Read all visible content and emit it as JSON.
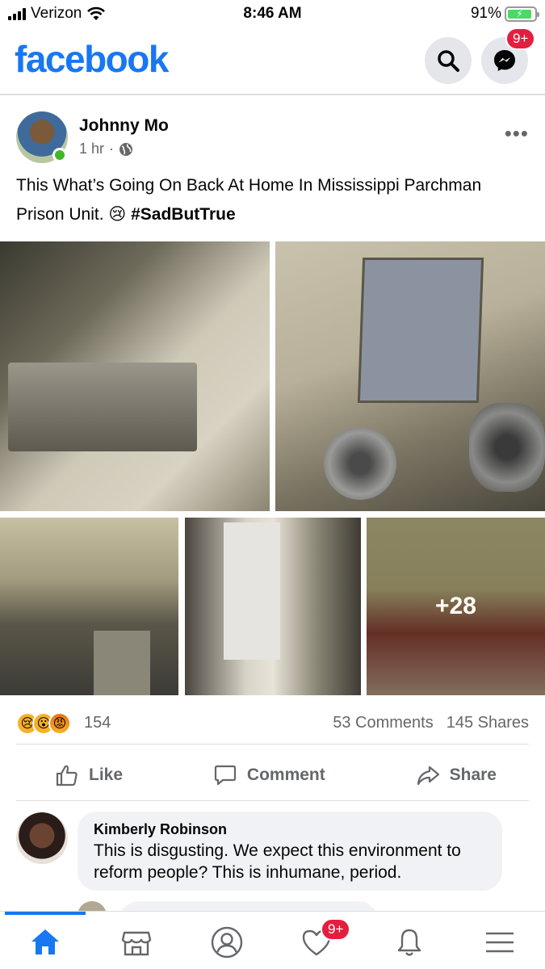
{
  "status_bar": {
    "carrier": "Verizon",
    "time": "8:46 AM",
    "battery": "91%",
    "battery_level": 0.91
  },
  "header": {
    "logo": "facebook",
    "messenger_badge": "9+",
    "brand_color": "#1877f2"
  },
  "post": {
    "author": "Johnny Mo",
    "time_ago": "1 hr",
    "privacy_icon": "globe-icon",
    "text": "This What’s Going On Back At Home In Mississippi Parchman Prison Unit. 😢",
    "hashtag": "#SadButTrue",
    "extra_photos": "+28",
    "reactions": {
      "icons": [
        "sad",
        "wow",
        "angry"
      ],
      "count": "154"
    },
    "comments_count": "53 Comments",
    "shares_count": "145 Shares",
    "actions": {
      "like": "Like",
      "comment": "Comment",
      "share": "Share"
    }
  },
  "comments": [
    {
      "author": "Kimberly Robinson",
      "text": "This is disgusting. We expect this environment to reform people? This is inhumane, period."
    }
  ],
  "bottom_nav": {
    "items": [
      "home-icon",
      "marketplace-icon",
      "profile-icon",
      "dating-icon",
      "notifications-icon",
      "menu-icon"
    ],
    "dating_badge": "9+",
    "active": "home"
  }
}
